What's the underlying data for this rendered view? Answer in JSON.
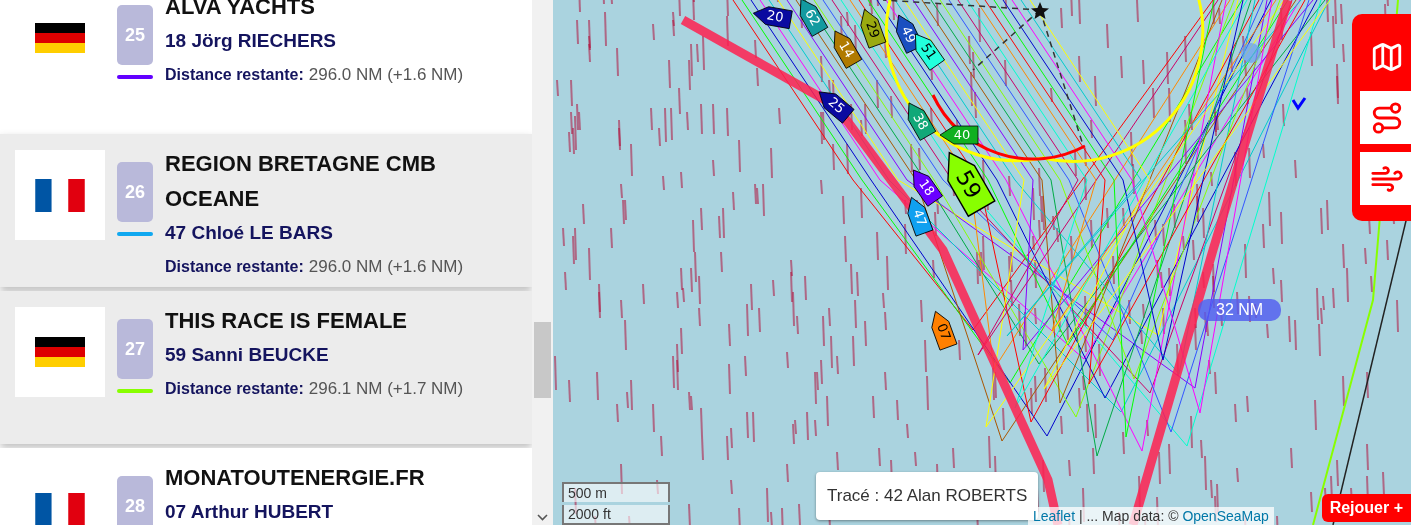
{
  "ranking": [
    {
      "rank": "25",
      "team": "ALVA YACHTS",
      "skipper": "18 Jörg RIECHERS",
      "color": "#6200ff",
      "kind": "de",
      "highlighted": false,
      "distance_label": "Distance restante:",
      "distance_value": "296.0 NM (+1.6 NM)"
    },
    {
      "rank": "26",
      "team": "REGION BRETAGNE CMB OCEANE",
      "skipper": "47 Chloé LE BARS",
      "color": "#10a8f0",
      "kind": "fr",
      "highlighted": true,
      "distance_label": "Distance restante:",
      "distance_value": "296.0 NM (+1.6 NM)"
    },
    {
      "rank": "27",
      "team": "THIS RACE IS FEMALE",
      "skipper": "59 Sanni BEUCKE",
      "color": "#88ff00",
      "kind": "de",
      "highlighted": true,
      "distance_label": "Distance restante:",
      "distance_value": "296.1 NM (+1.7 NM)"
    },
    {
      "rank": "28",
      "team": "MONATOUTENERGIE.FR",
      "skipper": "07 Arthur HUBERT",
      "kind": "fr",
      "highlighted": false
    }
  ],
  "map": {
    "boats": [
      {
        "number": "20",
        "color": "#0a0aa0"
      },
      {
        "number": "62",
        "color": "#139aa0"
      },
      {
        "number": "29",
        "color": "#9aaa10"
      },
      {
        "number": "14",
        "color": "#b07a00"
      },
      {
        "number": "49",
        "color": "#1a4fc0"
      },
      {
        "number": "51",
        "color": "#22ffdd"
      },
      {
        "number": "25",
        "color": "#0a0aa0"
      },
      {
        "number": "38",
        "color": "#10a878"
      },
      {
        "number": "40",
        "color": "#10b020"
      },
      {
        "number": "59",
        "color": "#88ff00"
      },
      {
        "number": "18",
        "color": "#6a00ff"
      },
      {
        "number": "47",
        "color": "#10a0f0"
      },
      {
        "number": "07",
        "color": "#ff8000"
      }
    ],
    "distance_label": "32 NM",
    "scale": [
      "500 m",
      "2000 ft"
    ],
    "tooltip": "Tracé : 42 Alan ROBERTS",
    "attribution": {
      "link": "Leaflet",
      "text": " | ... Map data: © ",
      "source": "OpenSeaMap"
    },
    "controls": [
      {
        "kind": "map",
        "selected": true
      },
      {
        "kind": "route",
        "selected": false
      },
      {
        "kind": "wind",
        "selected": false
      }
    ],
    "replay_button": "Rejouer +"
  }
}
